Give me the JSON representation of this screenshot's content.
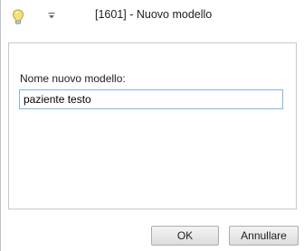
{
  "window": {
    "title": "[1601] - Nuovo modello"
  },
  "icons": {
    "app": "lightbulb-icon",
    "quick_access": "quick-access-dropdown-icon"
  },
  "form": {
    "label": "Nome nuovo modello:",
    "input_value": "paziente testo"
  },
  "buttons": {
    "ok_label": "OK",
    "cancel_label": "Annullare"
  },
  "colors": {
    "input_border": "#7eb4ea",
    "panel_border": "#c8c8c8",
    "button_gradient_top": "#f4f4f4",
    "button_gradient_bottom": "#dcdcdc"
  }
}
